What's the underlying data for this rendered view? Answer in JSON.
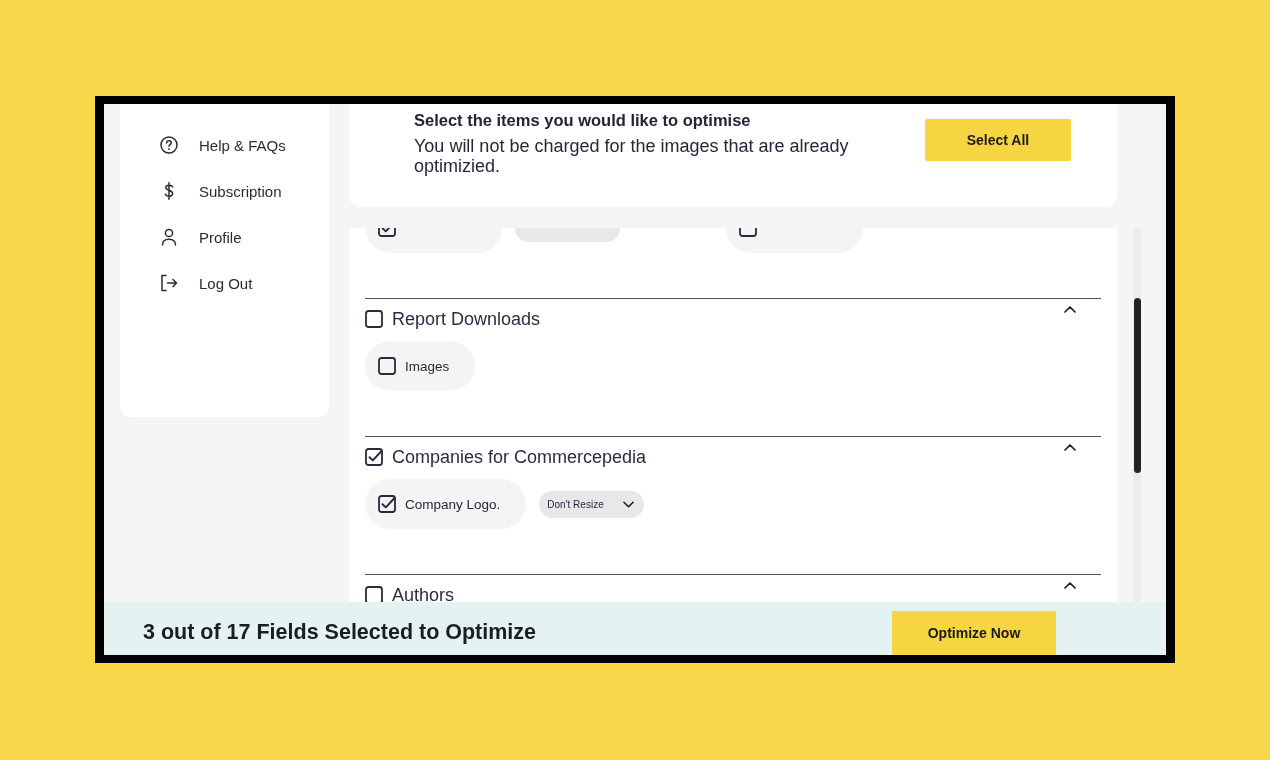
{
  "sidebar": {
    "items": [
      {
        "label": "Help & FAQs"
      },
      {
        "label": "Subscription"
      },
      {
        "label": "Profile"
      },
      {
        "label": "Log Out"
      }
    ]
  },
  "header": {
    "title": "Select the items you would like to optimise",
    "note": "You will not be charged for the images that are already optimizied.",
    "select_all_button": "Select All"
  },
  "sections": [
    {
      "items": [
        {
          "checked": true,
          "resize_menu": true
        },
        {
          "checked": false
        }
      ]
    },
    {
      "title": "Report Downloads",
      "checked": false,
      "expanded": true,
      "items": [
        {
          "label": "Images",
          "checked": false
        }
      ]
    },
    {
      "title": "Companies for Commercepedia",
      "checked": true,
      "expanded": true,
      "items": [
        {
          "label": "Company Logo.",
          "checked": true,
          "resize": "Don't Resize"
        }
      ]
    },
    {
      "title": "Authors",
      "checked": false,
      "expanded": true
    }
  ],
  "footer": {
    "summary": "3 out of 17 Fields Selected to Optimize",
    "optimize_button": "Optimize Now"
  }
}
